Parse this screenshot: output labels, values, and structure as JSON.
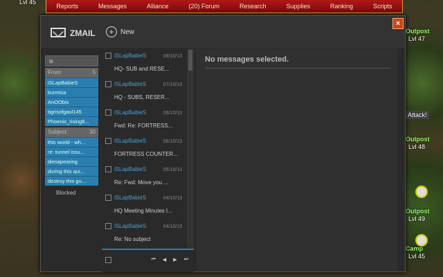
{
  "topnav": [
    "Reports",
    "Messages",
    "Alliance",
    "(20) Forum",
    "Research",
    "Supplies",
    "Ranking",
    "Scripts"
  ],
  "map_labels": {
    "top_left_lvl": "Lvl 45",
    "right_outpost1": "Outpost",
    "right_lvl1": "Lvl 47",
    "attack": "Attack!",
    "right_outpost2": "Outpost",
    "right_lvl2": "Lvl 48",
    "right_outpost3": "Outpost",
    "right_lvl3": "Lvl 49",
    "camp": "Camp",
    "camp_lvl": "Lvl 45"
  },
  "close_label": "×",
  "header": {
    "title": "ZMAIL",
    "new_label": "New",
    "new_icon": "plus-icon"
  },
  "search": {
    "value": "is"
  },
  "filters": {
    "from": {
      "label": "From:",
      "count": "5",
      "items": [
        "iSLapBabieS",
        "kurmisa",
        "AnOObis",
        "tigrisofgaul145",
        "Phoenix_rising8..."
      ]
    },
    "subject": {
      "label": "Subject:",
      "count": "30",
      "items": [
        "this world - wh...",
        "re: tunnel issu...",
        "diesapearing",
        "during this qui...",
        "destroy this gu..."
      ]
    },
    "blocked_label": "Blocked"
  },
  "messages": [
    {
      "sender": "iSLapBabieS",
      "date": "08/10/13",
      "subject": "HQ- SUB and RESE..."
    },
    {
      "sender": "iSLapBabieS",
      "date": "07/10/13",
      "subject": "HQ - SUBS, RESER..."
    },
    {
      "sender": "iSLapBabieS",
      "date": "06/10/13",
      "subject": "Fwd: Re: FORTRESS..."
    },
    {
      "sender": "iSLapBabieS",
      "date": "06/10/13",
      "subject": "FORTRESS COUNTER..."
    },
    {
      "sender": "iSLapBabieS",
      "date": "05/10/13",
      "subject": "Re: Fwd: Move you ..."
    },
    {
      "sender": "iSLapBabieS",
      "date": "04/10/13",
      "subject": "HQ Meeting Minutes l..."
    },
    {
      "sender": "iSLapBabieS",
      "date": "04/10/13",
      "subject": "Re: No subject"
    }
  ],
  "pager": [
    "⏮",
    "◀",
    "▶",
    "⏭"
  ],
  "reading": {
    "empty_text": "No messages selected."
  }
}
